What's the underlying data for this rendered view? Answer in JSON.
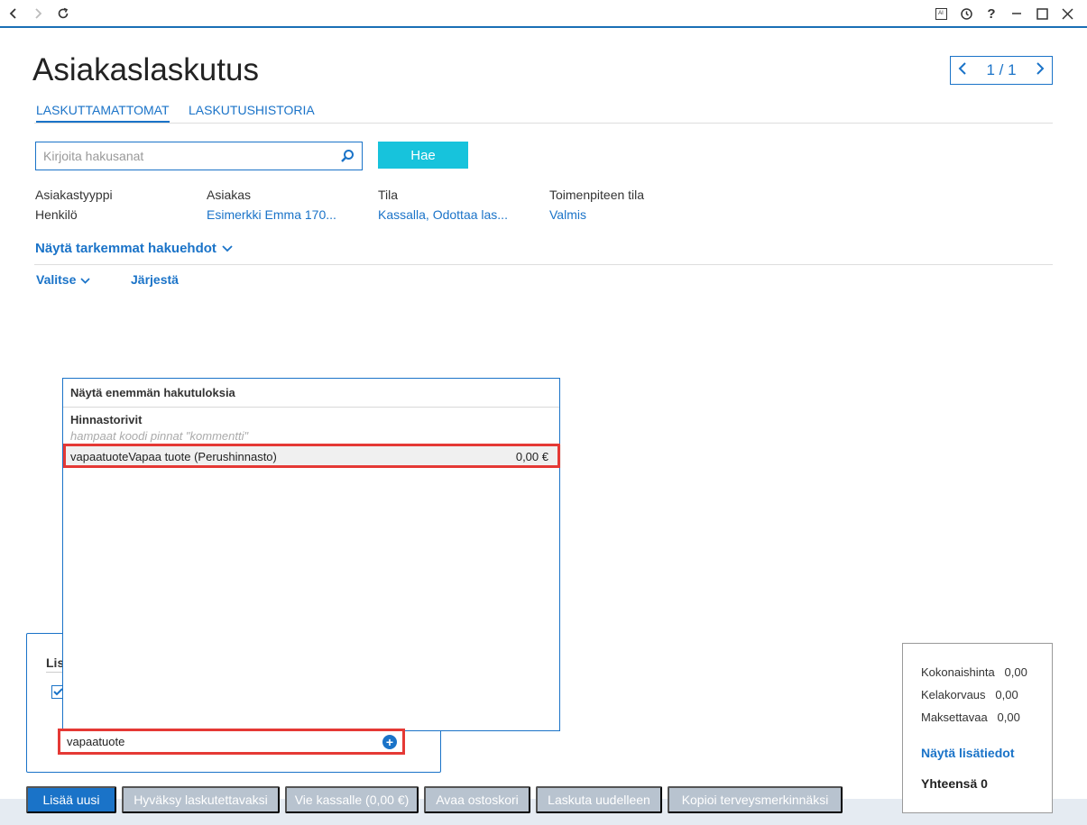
{
  "window": {
    "icons": [
      "back-icon",
      "forward-icon",
      "refresh-icon",
      "ai-icon",
      "history-icon",
      "help-icon",
      "minimize-icon",
      "maximize-icon",
      "close-icon"
    ],
    "ai_label": "AI",
    "help_label": "?"
  },
  "page": {
    "title": "Asiakaslaskutus",
    "pager": "1 / 1"
  },
  "tabs": [
    {
      "label": "LASKUTTAMATTOMAT",
      "active": true
    },
    {
      "label": "LASKUTUSHISTORIA",
      "active": false
    }
  ],
  "search": {
    "placeholder": "Kirjoita hakusanat",
    "button": "Hae"
  },
  "filters": [
    {
      "label": "Asiakastyyppi",
      "value": "Henkilö"
    },
    {
      "label": "Asiakas",
      "value": "Esimerkki Emma 170..."
    },
    {
      "label": "Tila",
      "value": "Kassalla, Odottaa las..."
    },
    {
      "label": "Toimenpiteen tila",
      "value": "Valmis"
    }
  ],
  "more_filters": "Näytä tarkemmat hakuehdot",
  "actions": {
    "select": "Valitse",
    "sort": "Järjestä"
  },
  "panel": {
    "title_partial": "Lis"
  },
  "dropdown": {
    "header": "Näytä enemmän hakutuloksia",
    "group": "Hinnastorivit",
    "hint": "hampaat koodi pinnat  \"kommentti\"",
    "row": {
      "name": "vapaatuoteVapaa tuote (Perushinnasto)",
      "price": "0,00 €"
    }
  },
  "product_input": {
    "value": "vapaatuote"
  },
  "summary": {
    "total_price_label": "Kokonaishinta",
    "total_price": "0,00",
    "kela_label": "Kelakorvaus",
    "kela": "0,00",
    "payable_label": "Maksettavaa",
    "payable": "0,00",
    "details_link": "Näytä lisätiedot",
    "total": "Yhteensä 0"
  },
  "buttons": {
    "add_new": "Lisää uusi",
    "approve": "Hyväksy laskutettavaksi",
    "to_cashier": "Vie kassalle (0,00 €)",
    "open_cart": "Avaa ostoskori",
    "rebill": "Laskuta uudelleen",
    "copy_health": "Kopioi terveysmerkinnäksi"
  },
  "colors": {
    "accent": "#1a73c8",
    "search_button": "#17c3dc",
    "highlight": "#e53935",
    "disabled_button": "#b8c3cf"
  }
}
